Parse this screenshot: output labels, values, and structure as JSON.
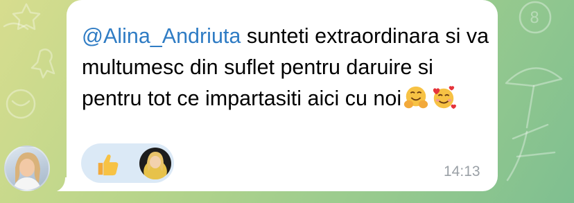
{
  "message": {
    "mention": "@Alina_Andriuta",
    "text": " sunteti extraordinara si va multumesc din suflet pentru daruire si pentru tot ce impartasiti aici cu noi",
    "emojis": [
      "hugging-face",
      "smiling-face-with-hearts"
    ],
    "timestamp": "14:13"
  },
  "reactions": [
    {
      "emoji": "thumbs-up"
    }
  ],
  "colors": {
    "mention": "#2f7cc4",
    "bubble": "#ffffff",
    "reaction_bg": "#dbe9f6",
    "time": "#9aa0a6"
  }
}
